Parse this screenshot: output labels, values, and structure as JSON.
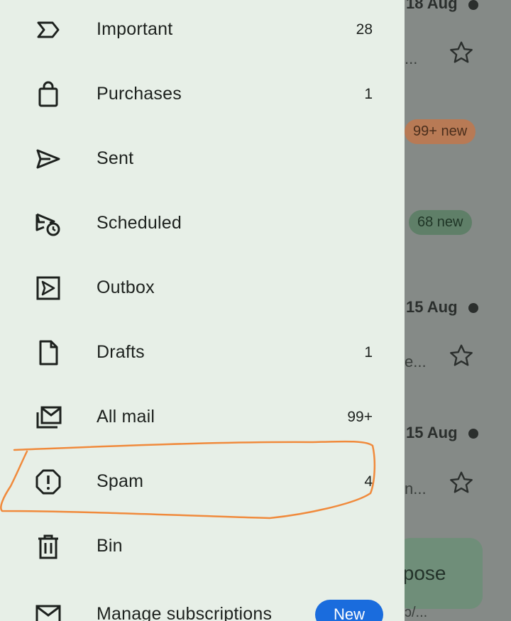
{
  "background": {
    "dates": [
      "18 Aug",
      "15 Aug",
      "15 Aug"
    ],
    "ellipsis": [
      "...",
      "e...",
      "n..."
    ],
    "pills": [
      "99+ new",
      "68 new"
    ],
    "compose_label": "ıpose",
    "snippet": "ɔ/..."
  },
  "drawer": {
    "items": [
      {
        "label": "Important",
        "count": "28",
        "icon": "important-icon"
      },
      {
        "label": "Purchases",
        "count": "1",
        "icon": "shopping-bag-icon"
      },
      {
        "label": "Sent",
        "count": "",
        "icon": "send-icon"
      },
      {
        "label": "Scheduled",
        "count": "",
        "icon": "schedule-send-icon"
      },
      {
        "label": "Outbox",
        "count": "",
        "icon": "outbox-icon"
      },
      {
        "label": "Drafts",
        "count": "1",
        "icon": "draft-icon"
      },
      {
        "label": "All mail",
        "count": "99+",
        "icon": "all-mail-icon"
      },
      {
        "label": "Spam",
        "count": "4",
        "icon": "spam-icon"
      },
      {
        "label": "Bin",
        "count": "",
        "icon": "trash-icon"
      },
      {
        "label": "Manage subscriptions",
        "badge": "New",
        "icon": "mail-icon"
      }
    ]
  },
  "colors": {
    "drawer_bg": "#e7efe7",
    "annotation": "#f08a3c",
    "badge": "#1a6cdd"
  }
}
